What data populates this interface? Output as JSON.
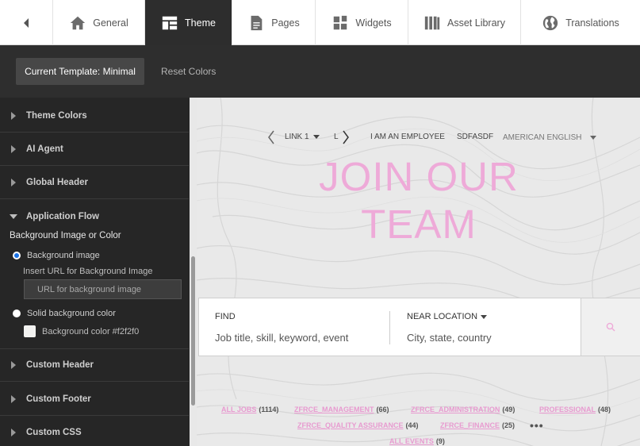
{
  "tabs": [
    {
      "label": "General",
      "icon": "home-icon"
    },
    {
      "label": "Theme",
      "icon": "theme-layout-icon",
      "active": true
    },
    {
      "label": "Pages",
      "icon": "page-icon"
    },
    {
      "label": "Widgets",
      "icon": "widgets-icon"
    },
    {
      "label": "Asset Library",
      "icon": "library-icon"
    },
    {
      "label": "Translations",
      "icon": "globe-icon"
    }
  ],
  "toolbar": {
    "template_label": "Current Template: Minimal",
    "reset_label": "Reset Colors"
  },
  "sidebar": {
    "sections": {
      "theme_colors": "Theme Colors",
      "ai_agent": "AI Agent",
      "global_header": "Global Header",
      "application_flow": "Application Flow",
      "custom_header": "Custom Header",
      "custom_footer": "Custom Footer",
      "custom_css": "Custom CSS"
    },
    "app_flow": {
      "subtitle": "Background Image or Color",
      "bg_image_label": "Background image",
      "url_label": "Insert URL for Background Image",
      "url_placeholder": "URL for background image",
      "solid_label": "Solid background color",
      "color_label": "Background color #f2f2f0",
      "selected": "Background image"
    }
  },
  "preview": {
    "nav": {
      "link1": "LINK 1",
      "link2": "L",
      "employee": "I AM AN EMPLOYEE",
      "sdfasdf": "SDFASDF",
      "language": "AMERICAN ENGLISH"
    },
    "hero": {
      "line1": "JOIN OUR",
      "line2": "TEAM"
    },
    "search": {
      "find_label": "FIND",
      "find_placeholder": "Job title, skill, keyword, event",
      "location_label": "NEAR LOCATION",
      "location_placeholder": "City, state, country"
    },
    "categories": [
      {
        "name": "ALL JOBS",
        "count": "(1114)"
      },
      {
        "name": "ZFRCE_MANAGEMENT",
        "count": "(66)"
      },
      {
        "name": "ZFRCE_ADMINISTRATION",
        "count": "(49)"
      },
      {
        "name": "PROFESSIONAL",
        "count": "(48)"
      },
      {
        "name": "ZFRCE_QUALITY ASSURANCE",
        "count": "(44)"
      },
      {
        "name": "ZFRCE_FINANCE",
        "count": "(25)"
      },
      {
        "name": "ALL EVENTS",
        "count": "(9)"
      }
    ],
    "more": "•••"
  },
  "colors": {
    "accent_pink": "#eeaad8",
    "active_tab_bg": "#2d2d2d",
    "sidebar_bg": "#262626",
    "radio_selected": "#1a73e8",
    "swatch": "#f2f2f0"
  }
}
